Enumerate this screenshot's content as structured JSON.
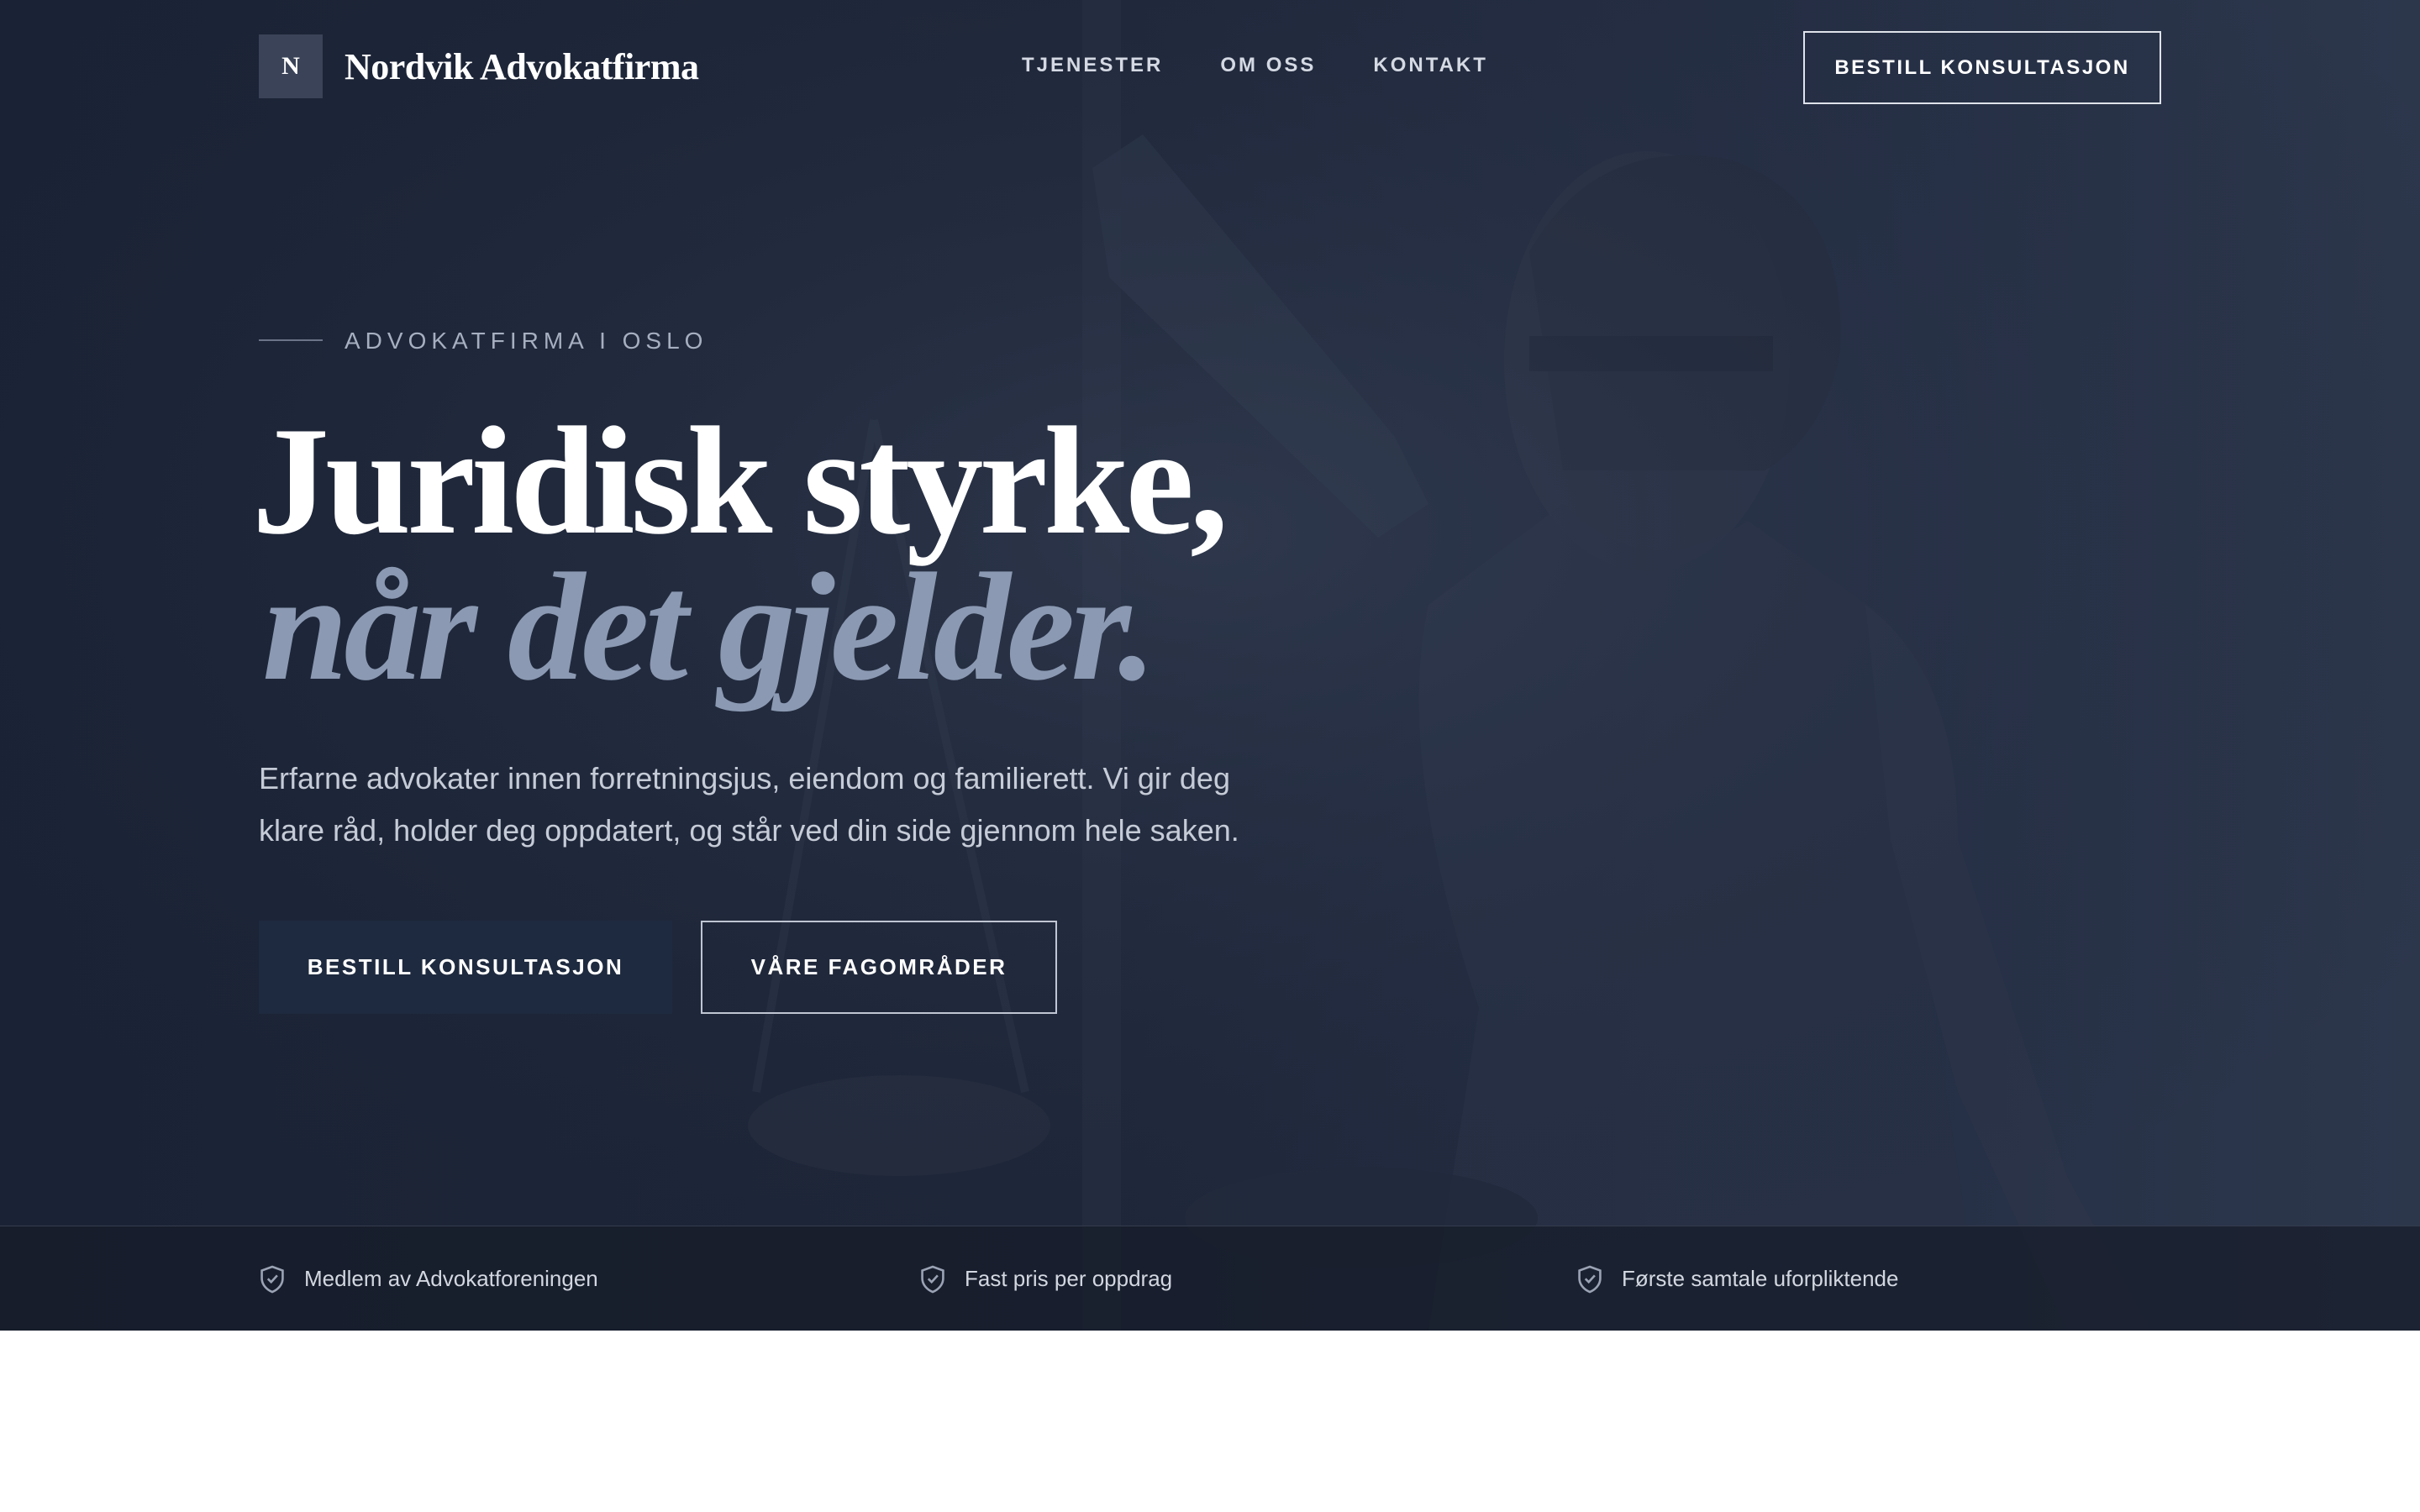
{
  "brand": {
    "mark": "N",
    "name": "Nordvik Advokatfirma"
  },
  "nav": {
    "items": [
      "TJENESTER",
      "OM OSS",
      "KONTAKT"
    ],
    "cta": "BESTILL KONSULTASJON"
  },
  "hero": {
    "eyebrow": "ADVOKATFIRMA I OSLO",
    "headline_line1": "Juridisk styrke,",
    "headline_line2": "når det gjelder.",
    "lead": "Erfarne advokater innen forretningsjus, eiendom og familierett. Vi gir deg klare råd, holder deg oppdatert, og står ved din side gjennom hele saken.",
    "primary_button": "BESTILL KONSULTASJON",
    "secondary_button": "VÅRE FAGOMRÅDER"
  },
  "trust": {
    "items": [
      "Medlem av Advokatforeningen",
      "Fast pris per oppdrag",
      "Første samtale uforpliktende"
    ],
    "icon": "shield-check-icon"
  },
  "colors": {
    "hero_bg": "#1e2639",
    "accent_text": "#8b99b2",
    "primary_button": "#1e2a3f"
  }
}
